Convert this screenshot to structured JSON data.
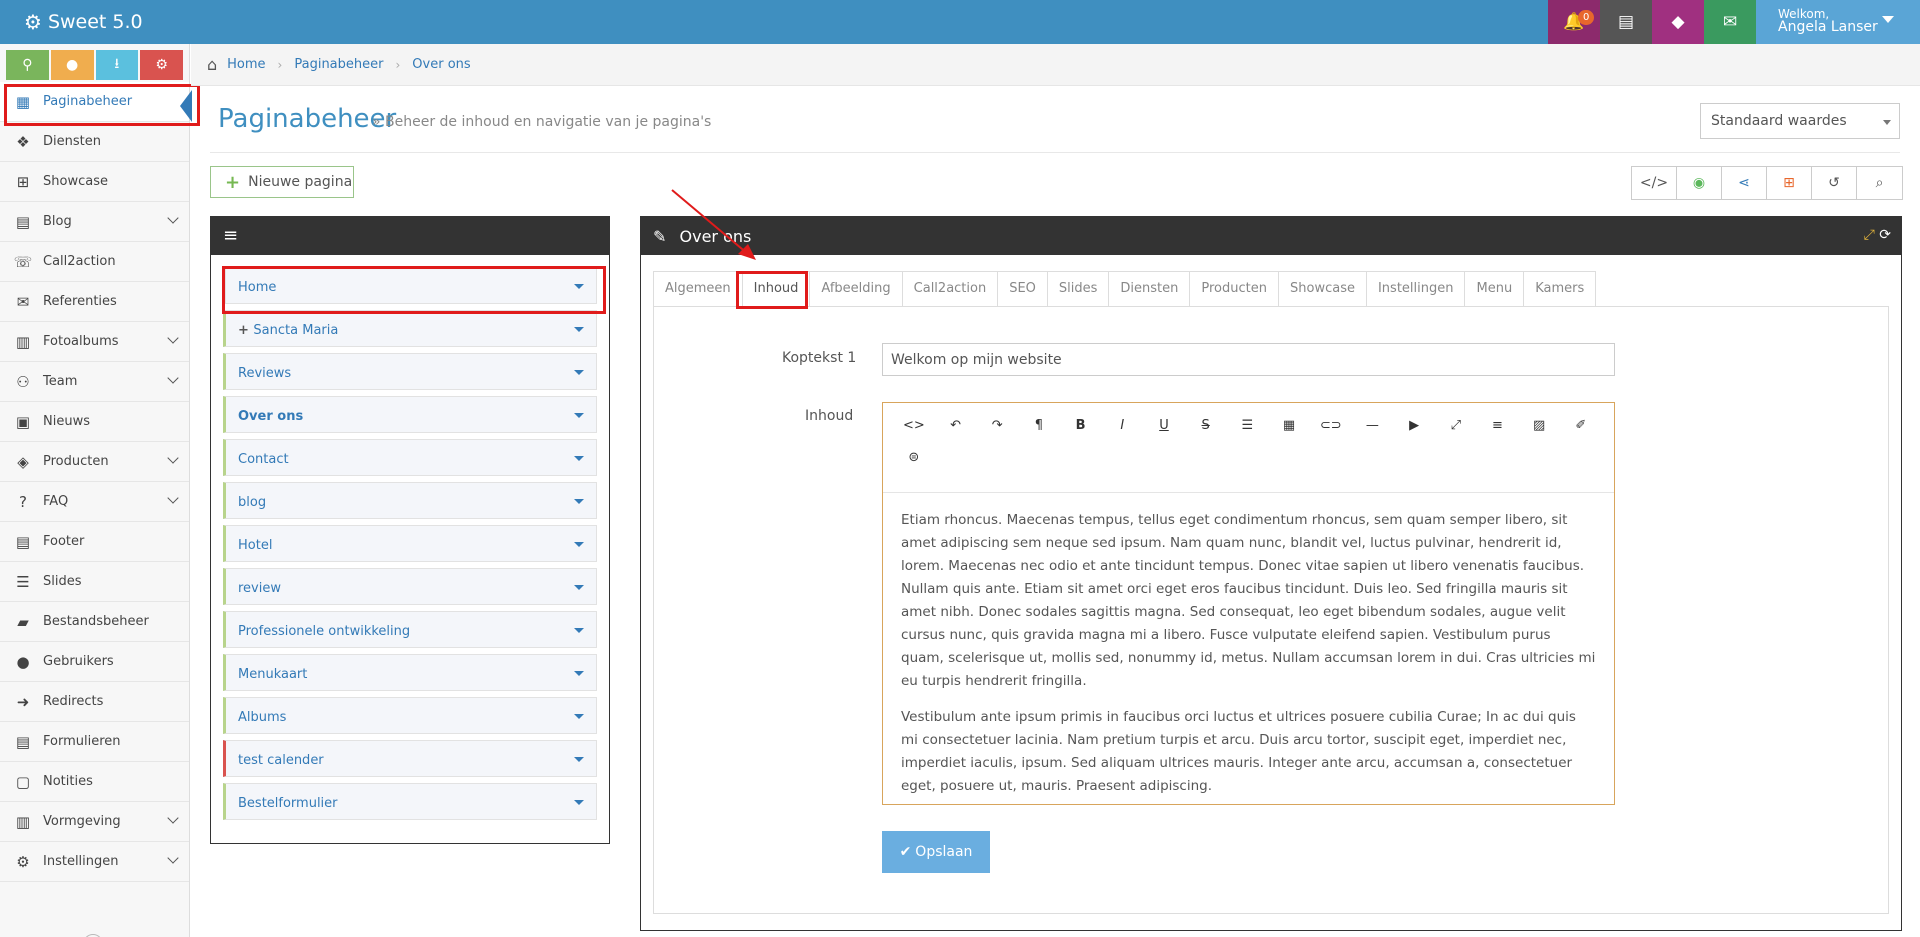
{
  "app": {
    "title": "Sweet 5.0",
    "notifications": "0",
    "welcome": "Welkom,",
    "user": "Angela Lanser"
  },
  "colors": {
    "brand": "#3f8fc0",
    "notif_bg": "#8c2a6c",
    "dark_bg": "#555555",
    "magenta_bg": "#a03080",
    "green_bg": "#3a9a5f",
    "user_bg": "#5aa5d6"
  },
  "quick_buttons": [
    {
      "icon": "map-marker-icon",
      "color": "#7ab55c"
    },
    {
      "icon": "user-icon",
      "color": "#f0ad4e"
    },
    {
      "icon": "download-icon",
      "color": "#5bc0de"
    },
    {
      "icon": "gears-icon",
      "color": "#d9534f"
    }
  ],
  "sidebar": {
    "items": [
      {
        "label": "Paginabeheer",
        "icon": "table-icon"
      },
      {
        "label": "Diensten",
        "icon": "cubes-icon"
      },
      {
        "label": "Showcase",
        "icon": "grid-icon"
      },
      {
        "label": "Blog",
        "icon": "file-icon"
      },
      {
        "label": "Call2action",
        "icon": "phone-icon"
      },
      {
        "label": "Referenties",
        "icon": "comments-icon"
      },
      {
        "label": "Fotoalbums",
        "icon": "book-icon"
      },
      {
        "label": "Team",
        "icon": "users-icon"
      },
      {
        "label": "Nieuws",
        "icon": "newspaper-icon"
      },
      {
        "label": "Producten",
        "icon": "tags-icon"
      },
      {
        "label": "FAQ",
        "icon": "question-icon"
      },
      {
        "label": "Footer",
        "icon": "list-alt-icon"
      },
      {
        "label": "Slides",
        "icon": "sliders-icon"
      },
      {
        "label": "Bestandsbeheer",
        "icon": "folder-open-icon"
      },
      {
        "label": "Gebruikers",
        "icon": "user-icon"
      },
      {
        "label": "Redirects",
        "icon": "arrow-circle-icon"
      },
      {
        "label": "Formulieren",
        "icon": "form-icon"
      },
      {
        "label": "Notities",
        "icon": "note-icon"
      },
      {
        "label": "Vormgeving",
        "icon": "layout-icon"
      },
      {
        "label": "Instellingen",
        "icon": "gear-icon"
      }
    ]
  },
  "breadcrumb": [
    "Home",
    "Paginabeheer",
    "Over ons"
  ],
  "header": {
    "title": "Paginabeheer",
    "subtitle": "» Beheer de inhoud en navigatie van je pagina's",
    "select_value": "Standaard waardes"
  },
  "new_page_label": "Nieuwe pagina",
  "pages": [
    {
      "label": "Home"
    },
    {
      "label": "Sancta Maria"
    },
    {
      "label": "Reviews"
    },
    {
      "label": "Over ons"
    },
    {
      "label": "Contact"
    },
    {
      "label": "blog"
    },
    {
      "label": "Hotel"
    },
    {
      "label": "review"
    },
    {
      "label": "Professionele ontwikkeling"
    },
    {
      "label": "Menukaart"
    },
    {
      "label": "Albums"
    },
    {
      "label": "test calender"
    },
    {
      "label": "Bestelformulier"
    }
  ],
  "editor_panel": {
    "title": "Over ons",
    "tabs": [
      "Algemeen",
      "Inhoud",
      "Afbeelding",
      "Call2action",
      "SEO",
      "Slides",
      "Diensten",
      "Producten",
      "Showcase",
      "Instellingen",
      "Menu",
      "Kamers"
    ],
    "active_tab": "Inhoud",
    "koptekst_label": "Koptekst 1",
    "koptekst_value": "Welkom op mijn website",
    "inhoud_label": "Inhoud",
    "paragraphs": [
      "Etiam rhoncus. Maecenas tempus, tellus eget condimentum rhoncus, sem quam semper libero, sit amet adipiscing sem neque sed ipsum. Nam quam nunc, blandit vel, luctus pulvinar, hendrerit id, lorem. Maecenas nec odio et ante tincidunt tempus. Donec vitae sapien ut libero venenatis faucibus. Nullam quis ante. Etiam sit amet orci eget eros faucibus tincidunt. Duis leo. Sed fringilla mauris sit amet nibh. Donec sodales sagittis magna. Sed consequat, leo eget bibendum sodales, augue velit cursus nunc, quis gravida magna mi a libero. Fusce vulputate eleifend sapien. Vestibulum purus quam, scelerisque ut, mollis sed, nonummy id, metus. Nullam accumsan lorem in dui. Cras ultricies mi eu turpis hendrerit fringilla.",
      "Vestibulum ante ipsum primis in faucibus orci luctus et ultrices posuere cubilia Curae; In ac dui quis mi consectetuer lacinia. Nam pretium turpis et arcu. Duis arcu tortor, suscipit eget, imperdiet nec, imperdiet iaculis, ipsum. Sed aliquam ultrices mauris. Integer ante arcu, accumsan a, consectetuer eget, posuere ut, mauris. Praesent adipiscing."
    ],
    "save_label": "Opslaan"
  },
  "editor_toolbar": [
    "code-view-icon",
    "undo-icon",
    "redo-icon",
    "paragraph-icon",
    "bold-icon",
    "italic-icon",
    "underline-icon",
    "strikethrough-icon",
    "list-ul-icon",
    "table-icon",
    "link-icon",
    "horizontal-rule-icon",
    "video-icon",
    "fullscreen-icon",
    "align-icon",
    "image-icon",
    "clear-format-icon",
    "special-char-icon"
  ]
}
